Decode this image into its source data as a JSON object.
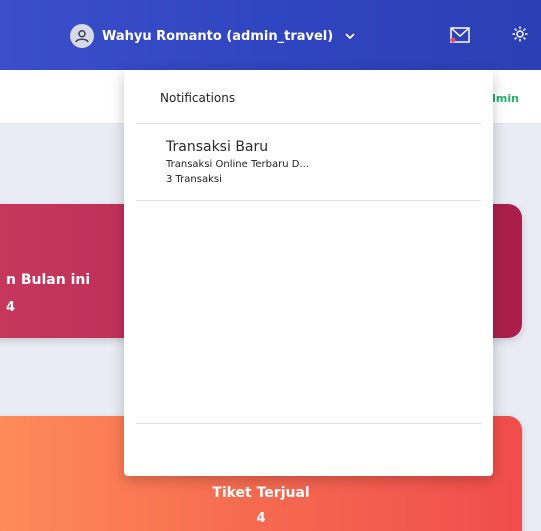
{
  "navbar": {
    "user_label": "Wahyu Romanto (admin_travel)",
    "icons": [
      "user-icon",
      "chevron-down-icon",
      "mail-icon",
      "gear-icon"
    ]
  },
  "breadcrumb": {
    "current": "dmin"
  },
  "cards": [
    {
      "title": "n Bulan ini",
      "value": "4"
    },
    {
      "title": "Tiket Terjual",
      "value": "4"
    }
  ],
  "notifications": {
    "header": "Notifications",
    "items": [
      {
        "title": "Transaksi Baru",
        "description": "Transaksi Online Terbaru D...",
        "count": "3 Transaksi"
      }
    ]
  },
  "colors": {
    "navbar": "#3047bf",
    "card_red": "#b9284f",
    "card_orange": "#f66a50",
    "breadcrumb_green": "#21b26b"
  }
}
